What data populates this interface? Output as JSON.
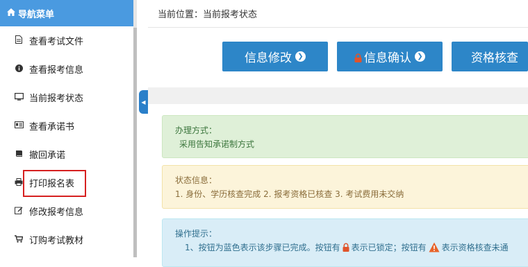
{
  "sidebar": {
    "title": "导航菜单",
    "items": [
      {
        "label": "查看考试文件",
        "icon": "document-icon"
      },
      {
        "label": "查看报考信息",
        "icon": "info-circle-icon"
      },
      {
        "label": "当前报考状态",
        "icon": "monitor-icon"
      },
      {
        "label": "查看承诺书",
        "icon": "id-card-icon"
      },
      {
        "label": "撤回承诺",
        "icon": "book-icon"
      },
      {
        "label": "打印报名表",
        "icon": "printer-icon"
      },
      {
        "label": "修改报考信息",
        "icon": "edit-icon"
      },
      {
        "label": "订购考试教材",
        "icon": "cart-icon"
      }
    ]
  },
  "breadcrumb": "当前位置：当前报考状态",
  "buttons": {
    "modify": "信息修改",
    "confirm": "信息确认",
    "verify": "资格核查"
  },
  "panels": {
    "method_title": "办理方式：",
    "method_text": "采用告知承诺制方式",
    "status_title": "状态信息：",
    "status_text": "1. 身份、学历核查完成 2. 报考资格已核查 3. 考试费用未交纳",
    "tips_title": "操作提示：",
    "tips_part1": "1、按钮为蓝色表示该步骤已完成。按钮有",
    "tips_part2": "表示已锁定；按钮有",
    "tips_part3": "表示资格核查未通"
  },
  "colors": {
    "accent": "#2d86c8",
    "header": "#4a9ae0",
    "highlight_border": "#d62020",
    "lock": "#e0542b",
    "warning": "#e8632a"
  }
}
